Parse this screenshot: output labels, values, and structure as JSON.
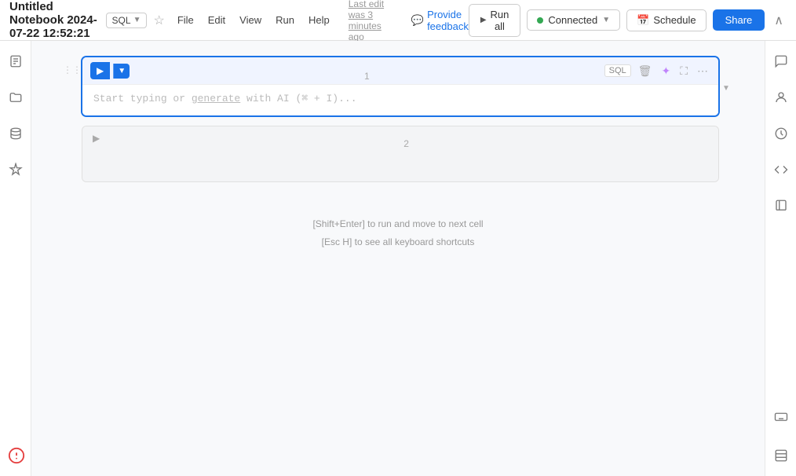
{
  "header": {
    "title": "Untitled Notebook 2024-07-22 12:52:21",
    "sql_badge": "SQL",
    "last_edit": "Last edit was 3 minutes ago",
    "feedback": "Provide feedback",
    "run_all": "Run all",
    "connected": "Connected",
    "schedule": "Schedule",
    "share": "Share"
  },
  "menu": {
    "items": [
      "File",
      "Edit",
      "View",
      "Run",
      "Help"
    ]
  },
  "cells": [
    {
      "number": "1",
      "type": "SQL",
      "placeholder": "Start typing or generate with AI (⌘ + I)...",
      "active": true
    },
    {
      "number": "2",
      "type": "",
      "placeholder": "",
      "active": false
    }
  ],
  "hints": [
    "[Shift+Enter] to run and move to next cell",
    "[Esc H] to see all keyboard shortcuts"
  ],
  "sidebar_left_icons": [
    "notebook-icon",
    "folder-icon",
    "database-icon",
    "sparkle-icon"
  ],
  "sidebar_right_icons": [
    "comment-icon",
    "user-icon",
    "history-icon",
    "code-icon",
    "library-icon"
  ],
  "sidebar_right_bottom_icons": [
    "keyboard-icon",
    "layout-icon"
  ],
  "notification_icon": "notification-icon"
}
